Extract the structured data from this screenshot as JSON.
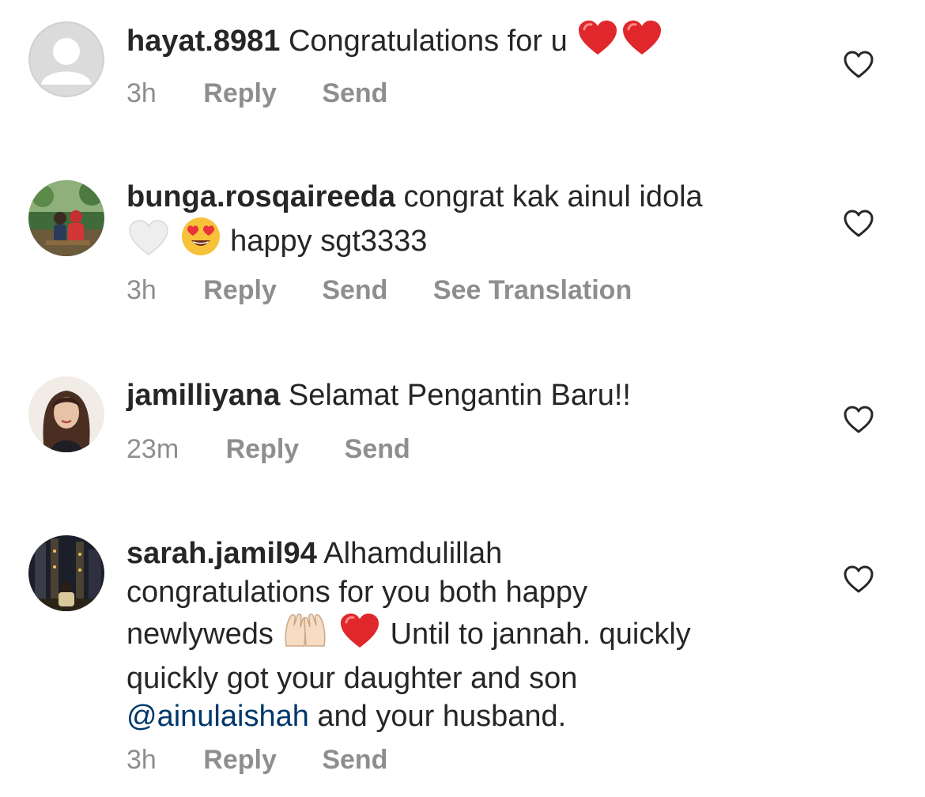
{
  "colors": {
    "text": "#262626",
    "meta": "#8e8e8e",
    "mention": "#00376b",
    "heart_red": "#e0272b"
  },
  "comments": [
    {
      "username": "hayat.8981",
      "text_parts": [
        "Congratulations for u"
      ],
      "emoji": [
        "red-heart",
        "red-heart"
      ],
      "time": "3h",
      "reply_label": "Reply",
      "send_label": "Send",
      "avatar": "default-avatar"
    },
    {
      "username": "bunga.rosqaireeda",
      "text_parts": [
        "congrat kak ainul idola",
        "happy sgt3333"
      ],
      "emoji": [
        "white-heart",
        "heart-eyes-face"
      ],
      "time": "3h",
      "reply_label": "Reply",
      "send_label": "Send",
      "translate_label": "See Translation",
      "avatar": "couple-photo"
    },
    {
      "username": "jamilliyana",
      "text_parts": [
        "Selamat Pengantin Baru!!"
      ],
      "time": "23m",
      "reply_label": "Reply",
      "send_label": "Send",
      "avatar": "woman-portrait"
    },
    {
      "username": "sarah.jamil94",
      "text_parts": [
        "Alhamdulillah",
        "congratulations for you both happy",
        "newlyweds",
        "Until to jannah. quickly",
        "quickly got your daughter and son",
        "and your husband."
      ],
      "mention": "@ainulaishah",
      "emoji": [
        "raising-hands",
        "red-heart"
      ],
      "time": "3h",
      "reply_label": "Reply",
      "send_label": "Send",
      "avatar": "night-city-photo"
    }
  ]
}
